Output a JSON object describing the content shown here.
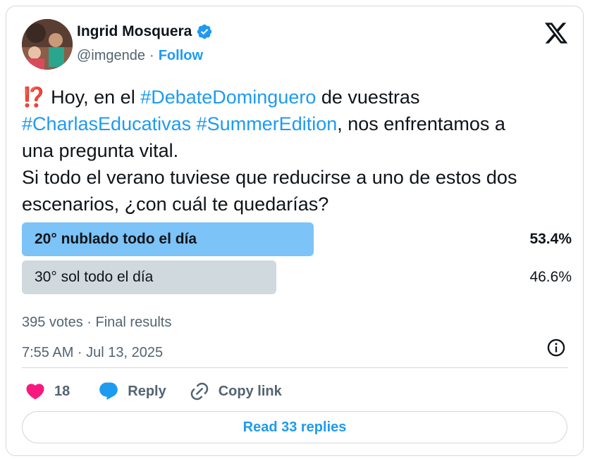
{
  "author": {
    "name": "Ingrid Mosquera",
    "handle": "@imgende",
    "separator": "·",
    "follow_label": "Follow",
    "verified": true
  },
  "tweet": {
    "emoji": "⁉️",
    "line1_pre": " Hoy, en el ",
    "hashtag1": "#DebateDominguero",
    "line1_post": " de vuestras",
    "hashtag2": "#CharlasEducativas",
    "space": " ",
    "hashtag3": "#SummerEdition",
    "line2_post": ", nos enfrentamos a",
    "line3": "una pregunta vital.",
    "line4": "Si todo el verano tuviese que reducirse a uno de estos dos",
    "line5": "escenarios, ¿con cuál te quedarías?"
  },
  "poll": {
    "options": [
      {
        "label": "20° nublado todo el día",
        "percent_label": "53.4%",
        "percent": 53.4,
        "winner": true
      },
      {
        "label": "30° sol todo el día",
        "percent_label": "46.6%",
        "percent": 46.6,
        "winner": false
      }
    ],
    "meta": "395 votes · Final results"
  },
  "timestamp": "7:55 AM · Jul 13, 2025",
  "actions": {
    "likes": "18",
    "reply_label": "Reply",
    "copy_link_label": "Copy link"
  },
  "read_replies_label": "Read 33 replies",
  "colors": {
    "accent": "#1d9bf0",
    "like": "#f91880",
    "winner_bar": "#7cc3f7",
    "loser_bar": "#cfd9de"
  },
  "icons": [
    "verified-badge-icon",
    "x-logo-icon",
    "info-icon",
    "heart-icon",
    "reply-bubble-icon",
    "link-icon"
  ]
}
